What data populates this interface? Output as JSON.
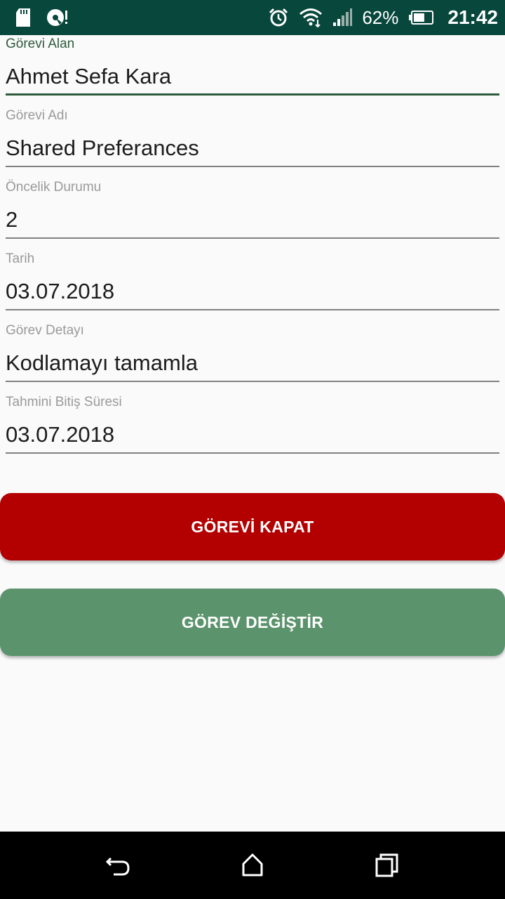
{
  "status_bar": {
    "left_icons": [
      "sd-card-icon",
      "media-scanner-icon"
    ],
    "right_icons": [
      "alarm-icon",
      "wifi-icon",
      "signal-icon",
      "battery-icon"
    ],
    "battery_percent": "62%",
    "battery_level": 0.62,
    "time": "21:42"
  },
  "form": {
    "fields": [
      {
        "label": "Görevi Alan",
        "value": "Ahmet Sefa Kara",
        "focused": true
      },
      {
        "label": "Görevi Adı",
        "value": "Shared Preferances",
        "focused": false
      },
      {
        "label": "Öncelik Durumu",
        "value": "2",
        "focused": false
      },
      {
        "label": "Tarih",
        "value": "03.07.2018",
        "focused": false
      },
      {
        "label": "Görev Detayı",
        "value": "Kodlamayı tamamla",
        "focused": false
      },
      {
        "label": "Tahmini Bitiş Süresi",
        "value": "03.07.2018",
        "focused": false
      }
    ]
  },
  "buttons": {
    "close_task_label": "GÖREVİ KAPAT",
    "change_task_label": "GÖREV DEĞİŞTİR"
  },
  "colors": {
    "status_bar": "#07473c",
    "accent": "#2f5b3d",
    "close_button": "#b30000",
    "change_button": "#5b936c"
  },
  "nav_bar": {
    "buttons": [
      "back-icon",
      "home-icon",
      "recents-icon"
    ]
  }
}
